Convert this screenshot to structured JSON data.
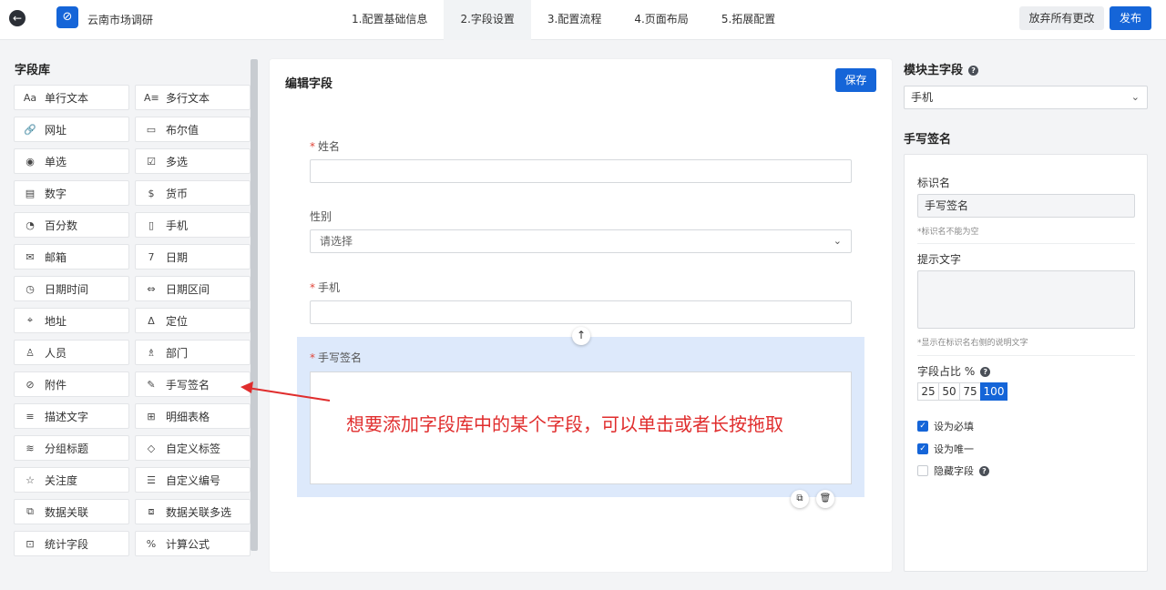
{
  "header": {
    "app_title": "云南市场调研",
    "steps": [
      "1.配置基础信息",
      "2.字段设置",
      "3.配置流程",
      "4.页面布局",
      "5.拓展配置"
    ],
    "discard_label": "放弃所有更改",
    "publish_label": "发布"
  },
  "library": {
    "title": "字段库",
    "items": [
      {
        "icon": "Aa",
        "label": "单行文本"
      },
      {
        "icon": "A≡",
        "label": "多行文本"
      },
      {
        "icon": "🔗",
        "label": "网址"
      },
      {
        "icon": "▭",
        "label": "布尔值"
      },
      {
        "icon": "◉",
        "label": "单选"
      },
      {
        "icon": "☑",
        "label": "多选"
      },
      {
        "icon": "▤",
        "label": "数字"
      },
      {
        "icon": "$",
        "label": "货币"
      },
      {
        "icon": "◔",
        "label": "百分数"
      },
      {
        "icon": "▯",
        "label": "手机"
      },
      {
        "icon": "✉",
        "label": "邮箱"
      },
      {
        "icon": "7",
        "label": "日期"
      },
      {
        "icon": "◷",
        "label": "日期时间"
      },
      {
        "icon": "⇔",
        "label": "日期区间"
      },
      {
        "icon": "⌖",
        "label": "地址"
      },
      {
        "icon": "Δ",
        "label": "定位"
      },
      {
        "icon": "♙",
        "label": "人员"
      },
      {
        "icon": "♗",
        "label": "部门"
      },
      {
        "icon": "⊘",
        "label": "附件"
      },
      {
        "icon": "✎",
        "label": "手写签名"
      },
      {
        "icon": "≡",
        "label": "描述文字"
      },
      {
        "icon": "⊞",
        "label": "明细表格"
      },
      {
        "icon": "≋",
        "label": "分组标题"
      },
      {
        "icon": "◇",
        "label": "自定义标签"
      },
      {
        "icon": "☆",
        "label": "关注度"
      },
      {
        "icon": "☰",
        "label": "自定义编号"
      },
      {
        "icon": "⧉",
        "label": "数据关联"
      },
      {
        "icon": "⧈",
        "label": "数据关联多选"
      },
      {
        "icon": "⊡",
        "label": "统计字段"
      },
      {
        "icon": "%",
        "label": "计算公式"
      }
    ]
  },
  "editor": {
    "title": "编辑字段",
    "save_label": "保存",
    "fields": {
      "name_label": "姓名",
      "gender_label": "性别",
      "gender_placeholder": "请选择",
      "phone_label": "手机",
      "signature_label": "手写签名"
    },
    "req_mark": "*",
    "annotation": "想要添加字段库中的某个字段，可以单击或者长按拖取"
  },
  "props": {
    "main_field_title": "模块主字段",
    "main_field_value": "手机",
    "section_title": "手写签名",
    "id_name_label": "标识名",
    "id_name_value": "手写签名",
    "id_name_hint": "*标识名不能为空",
    "tip_label": "提示文字",
    "tip_hint": "*显示在标识名右侧的说明文字",
    "ratio_label": "字段占比 %",
    "ratios": [
      "25",
      "50",
      "75",
      "100"
    ],
    "required_label": "设为必填",
    "unique_label": "设为唯一",
    "hidden_label": "隐藏字段"
  }
}
